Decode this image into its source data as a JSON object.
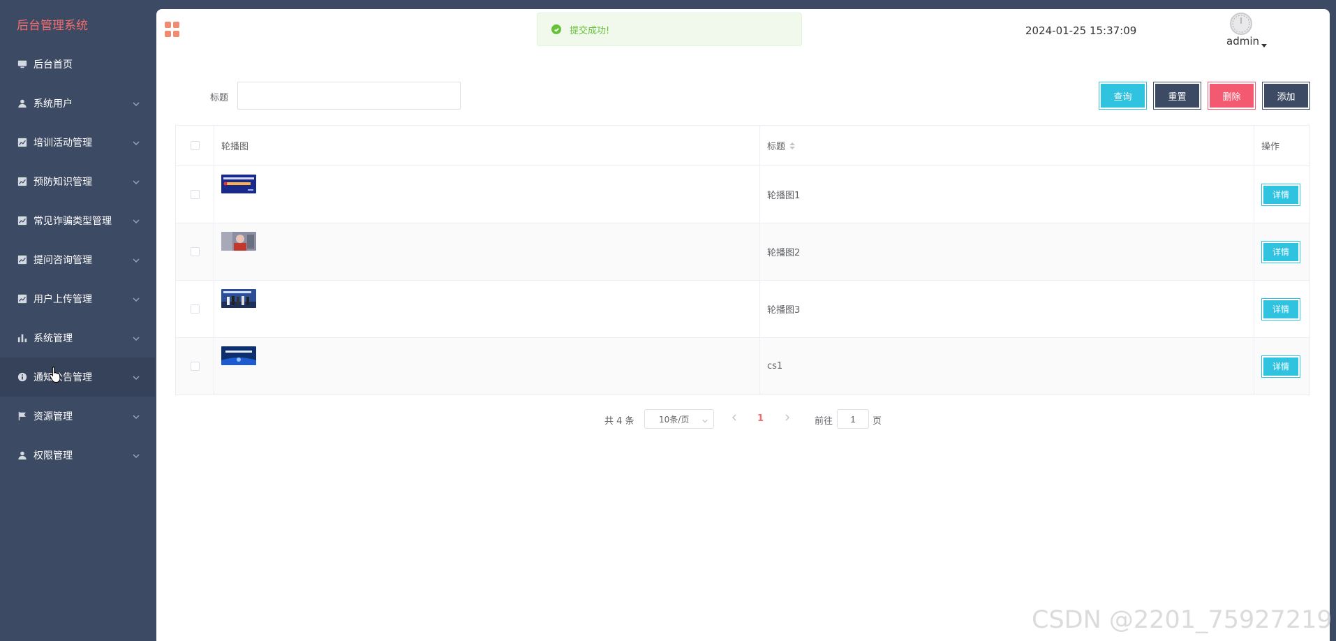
{
  "sidebar": {
    "brand": "后台管理系统",
    "items": [
      {
        "label": "后台首页",
        "icon": "monitor-icon"
      },
      {
        "label": "系统用户",
        "icon": "user-icon"
      },
      {
        "label": "培训活动管理",
        "icon": "chart-icon"
      },
      {
        "label": "预防知识管理",
        "icon": "chart-icon"
      },
      {
        "label": "常见诈骗类型管理",
        "icon": "chart-icon"
      },
      {
        "label": "提问咨询管理",
        "icon": "chart-icon"
      },
      {
        "label": "用户上传管理",
        "icon": "chart-icon"
      },
      {
        "label": "系统管理",
        "icon": "bar-chart-icon"
      },
      {
        "label": "通知公告管理",
        "icon": "info-icon"
      },
      {
        "label": "资源管理",
        "icon": "flag-icon"
      },
      {
        "label": "权限管理",
        "icon": "user-icon"
      }
    ],
    "active_index": 8
  },
  "header": {
    "toast": "提交成功!",
    "datetime": "2024-01-25 15:37:09",
    "username": "admin"
  },
  "search": {
    "label": "标题",
    "value": "",
    "placeholder": ""
  },
  "toolbar": {
    "query_label": "查询",
    "reset_label": "重置",
    "delete_label": "删除",
    "add_label": "添加"
  },
  "table": {
    "columns": [
      "轮播图",
      "标题",
      "操作"
    ],
    "rows": [
      {
        "title": "轮播图1",
        "action": "详情"
      },
      {
        "title": "轮播图2",
        "action": "详情"
      },
      {
        "title": "轮播图3",
        "action": "详情"
      },
      {
        "title": "cs1",
        "action": "详情"
      }
    ]
  },
  "pagination": {
    "total_text": "共 4 条",
    "page_size": "10条/页",
    "current_page": "1",
    "goto_label": "前往",
    "goto_value": "1",
    "page_suffix": "页"
  },
  "watermark": "CSDN @2201_75927219",
  "colors": {
    "sidebar_bg": "#3d4a64",
    "brand": "#f56c6c",
    "accent_cyan": "#2fc3e0",
    "danger": "#f35a72",
    "success": "#67c23a"
  }
}
